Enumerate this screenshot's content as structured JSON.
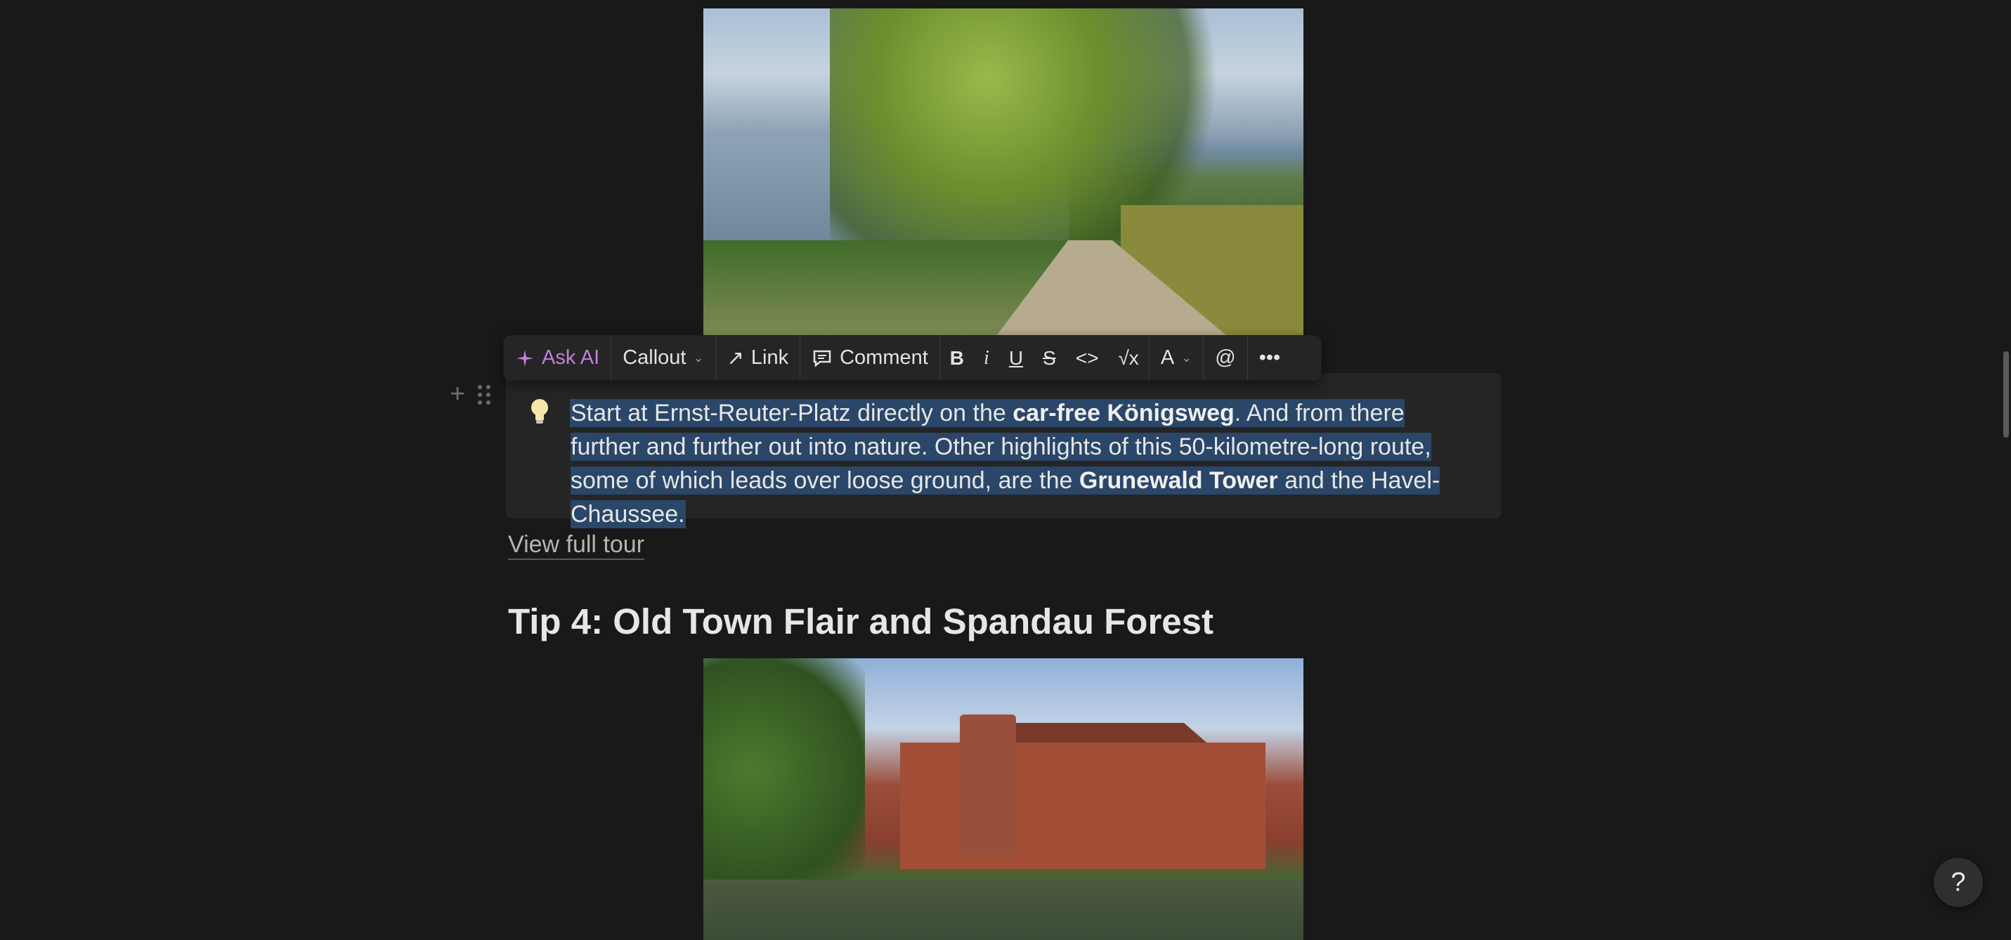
{
  "toolbar": {
    "ask_ai": "Ask AI",
    "block_type": "Callout",
    "link": "Link",
    "comment": "Comment",
    "bold": "B",
    "italic": "i",
    "underline": "U",
    "strike": "S",
    "color": "A",
    "mention": "@"
  },
  "callout": {
    "icon": "lightbulb-icon",
    "p1": "Start at Ernst-Reuter-Platz directly on the ",
    "b1": "car-free Königsweg",
    "p2": ". And from there further and further out into nature. Other highlights of this 50-kilometre-long route, some of which leads over loose ground, are the ",
    "b2": "Grunewald Tower",
    "p3": " and the Havel-Chaussee."
  },
  "link_text": "View full tour",
  "heading": "Tip 4: Old Town Flair and Spandau Forest",
  "help": "?",
  "colors": {
    "selection": "#2a4668",
    "ask_ai": "#c77dde",
    "background": "#191919"
  }
}
